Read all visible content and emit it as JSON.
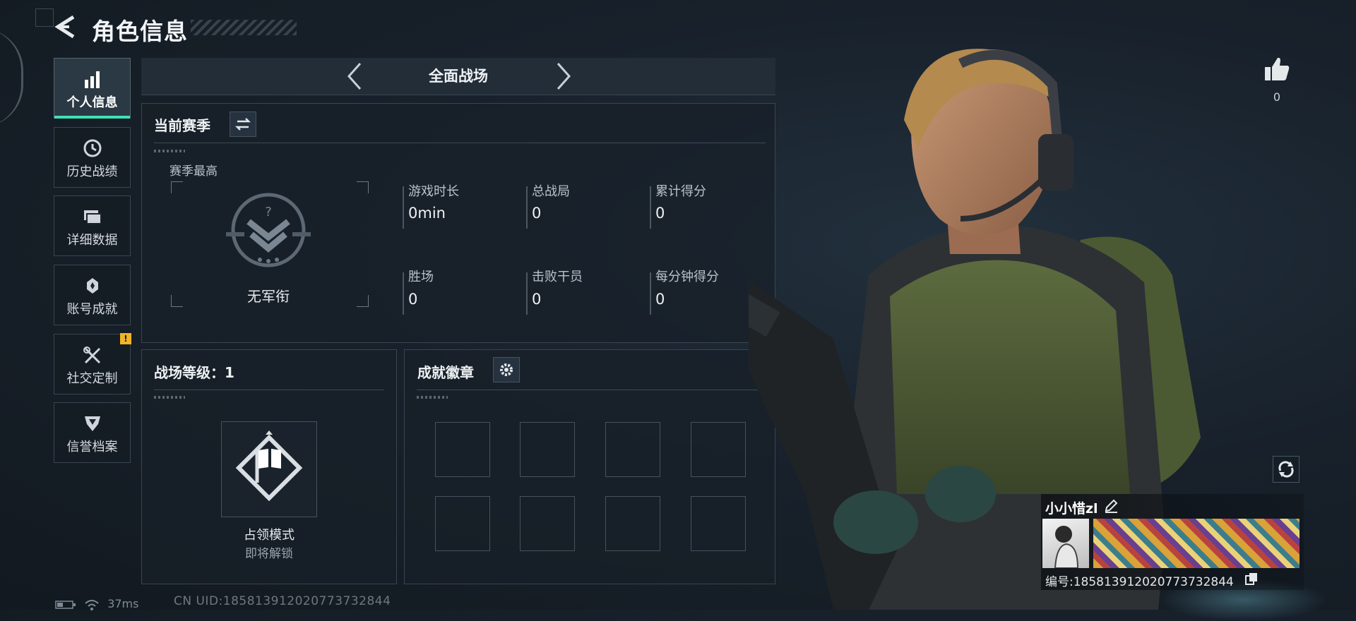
{
  "header": {
    "title": "角色信息"
  },
  "sidebar": {
    "items": [
      {
        "label": "个人信息",
        "icon": "bar-chart-icon",
        "active": true
      },
      {
        "label": "历史战绩",
        "icon": "clock-icon"
      },
      {
        "label": "详细数据",
        "icon": "folder-icon"
      },
      {
        "label": "账号成就",
        "icon": "medal-icon"
      },
      {
        "label": "社交定制",
        "icon": "tools-icon",
        "alert": "!"
      },
      {
        "label": "信誉档案",
        "icon": "shield-icon"
      }
    ]
  },
  "mode": {
    "label": "全面战场"
  },
  "season": {
    "title": "当前赛季",
    "best_label": "赛季最高",
    "rank_name": "无军衔",
    "stats": [
      {
        "label": "游戏时长",
        "value": "0min"
      },
      {
        "label": "总战局",
        "value": "0"
      },
      {
        "label": "累计得分",
        "value": "0"
      },
      {
        "label": "胜场",
        "value": "0"
      },
      {
        "label": "击败干员",
        "value": "0"
      },
      {
        "label": "每分钟得分",
        "value": "0"
      }
    ]
  },
  "level": {
    "title": "战场等级：1",
    "mode_name": "占领模式",
    "mode_status": "即将解锁"
  },
  "badges": {
    "title": "成就徽章",
    "slots": 8
  },
  "profile": {
    "likes": "0",
    "name": "小小惜zl",
    "id": "编号:1858139120207737328​44"
  },
  "status_bar": {
    "ping": "37ms",
    "uid": "CN UID:1858139120207737328​44"
  },
  "colors": {
    "accent": "#3fe0b5",
    "warning": "#f2b325"
  }
}
